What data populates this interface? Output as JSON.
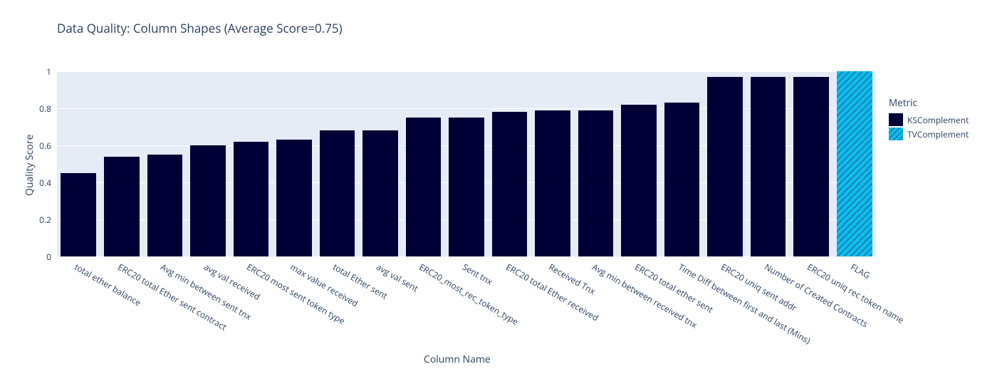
{
  "chart_data": {
    "type": "bar",
    "title": "Data Quality: Column Shapes (Average Score=0.75)",
    "xlabel": "Column Name",
    "ylabel": "Quality Score",
    "ylim": [
      0,
      1
    ],
    "yticks": [
      0,
      0.2,
      0.4,
      0.6,
      0.8,
      1
    ],
    "legend_title": "Metric",
    "legend_items": [
      "KSComplement",
      "TVComplement"
    ],
    "categories": [
      "total ether balance",
      "ERC20 total Ether sent contract",
      "Avg min between sent tnx",
      "avg val received",
      "ERC20 most sent token type",
      "max value received",
      "total Ether sent",
      "avg val sent",
      "ERC20_most_rec_token_type",
      "Sent tnx",
      "ERC20 total Ether received",
      "Received Tnx",
      "Avg min between received tnx",
      "ERC20 total ether sent",
      "Time Diff between first and last (Mins)",
      "ERC20 uniq sent addr",
      "Number of Created Contracts",
      "ERC20 uniq rec token name",
      "FLAG"
    ],
    "values": [
      0.45,
      0.54,
      0.55,
      0.6,
      0.62,
      0.63,
      0.68,
      0.68,
      0.75,
      0.75,
      0.78,
      0.79,
      0.79,
      0.82,
      0.83,
      0.97,
      0.97,
      0.97,
      1.0
    ],
    "metric_per_bar": [
      "KSComplement",
      "KSComplement",
      "KSComplement",
      "KSComplement",
      "KSComplement",
      "KSComplement",
      "KSComplement",
      "KSComplement",
      "KSComplement",
      "KSComplement",
      "KSComplement",
      "KSComplement",
      "KSComplement",
      "KSComplement",
      "KSComplement",
      "KSComplement",
      "KSComplement",
      "KSComplement",
      "TVComplement"
    ],
    "colors": {
      "KSComplement": "#000036",
      "TVComplement": "#03c4e9"
    }
  }
}
